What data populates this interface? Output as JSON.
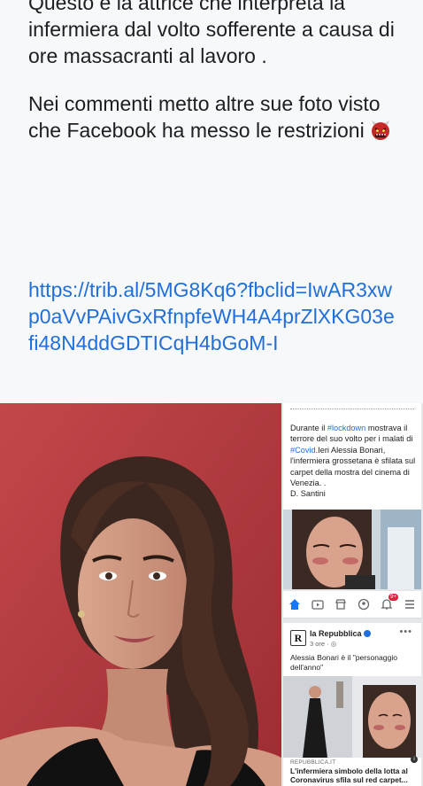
{
  "post": {
    "paragraph1": "Questo è la attrice che interpreta la infermiera dal volto sofferente a causa di ore massacranti al lavoro .",
    "paragraph2": "Nei commenti metto altre sue foto visto che Facebook ha messo le restrizioni",
    "emoji": "ogre-face",
    "link": "https://trib.al/5MG8Kq6?fbclid=IwAR3xwp0aVvPAivGxRfnpfeWH4A4prZlXKG03efi48N4ddGDTICqH4bGoM-I"
  },
  "tweet": {
    "part1": "Durante il ",
    "hashtag1": "#lockdown",
    "part2": " mostrava il terrore del suo volto per i malati di ",
    "hashtag2": "#Covid",
    "part3": ".Ieri Alessia Bonari, l'infermiera grossetana è sfilata sul carpet della mostra del cinema di Venezia. .",
    "author": "D. Santini"
  },
  "nav": {
    "badge": "9+",
    "icons": [
      "home-icon",
      "video-icon",
      "marketplace-icon",
      "groups-icon",
      "notifications-icon",
      "menu-icon"
    ]
  },
  "card": {
    "logo": "R",
    "page_name": "la Repubblica",
    "time": "3 ore · ",
    "text": "Alessia Bonari è il \"personaggio dell'anno\"",
    "source": "REPUBBLICA.IT",
    "headline": "L'infermiera simbolo della lotta al Coronavirus sfila sul red carpet..."
  },
  "colors": {
    "link": "#216fdb",
    "text": "#1c1e21",
    "photo_background": "#b73a3e",
    "notification_badge": "#e41e3f"
  }
}
